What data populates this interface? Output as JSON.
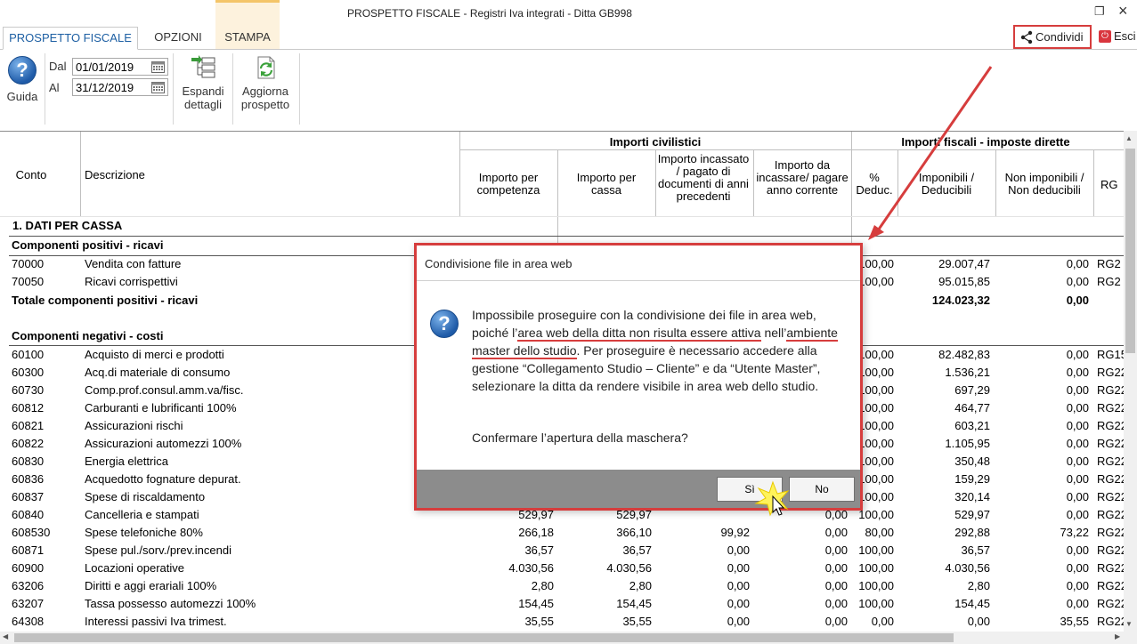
{
  "window": {
    "title": "PROSPETTO FISCALE - Registri Iva integrati - Ditta GB998",
    "restore_glyph": "❐",
    "close_glyph": "×"
  },
  "tabs": [
    {
      "label": "PROSPETTO FISCALE",
      "active": true
    },
    {
      "label": "OPZIONI",
      "active": false
    },
    {
      "label": "STAMPA",
      "active": false
    }
  ],
  "top_actions": {
    "share_label": "Condividi",
    "exit_label": "Esci"
  },
  "ribbon": {
    "help_label": "Guida",
    "from_label": "Dal",
    "from_value": "01/01/2019",
    "to_label": "Al",
    "to_value": "31/12/2019",
    "expand_line1": "Espandi",
    "expand_line2": "dettagli",
    "refresh_line1": "Aggiorna",
    "refresh_line2": "prospetto"
  },
  "grid": {
    "group_civil": "Importi civilistici",
    "group_fiscal": "Importi fiscali - imposte dirette",
    "columns": {
      "conto": "Conto",
      "descrizione": "Descrizione",
      "competenza": "Importo per competenza",
      "cassa": "Importo per cassa",
      "incassato": "Importo incassato / pagato di documenti di anni precedenti",
      "da_incassare": "Importo da incassare/ pagare anno corrente",
      "deduc": "% Deduc.",
      "imponibili": "Imponibili / Deducibili",
      "non_imponibili": "Non imponibili / Non deducibili",
      "rg": "RG"
    },
    "sections": {
      "dati_cassa": "1. DATI PER CASSA",
      "positivi": "Componenti positivi - ricavi",
      "totale_positivi": "Totale componenti positivi - ricavi",
      "totale_imponibili": "124.023,32",
      "totale_non_imponibili": "0,00",
      "negativi": "Componenti negativi - costi"
    },
    "positive_rows": [
      {
        "conto": "70000",
        "desc": "Vendita con fatture",
        "competenza": "",
        "cassa": "",
        "incassato": "",
        "da_incassare": "",
        "deduc": "100,00",
        "imponibili": "29.007,47",
        "non_imponibili": "0,00",
        "rg": "RG2"
      },
      {
        "conto": "70050",
        "desc": "Ricavi corrispettivi",
        "competenza": "",
        "cassa": "",
        "incassato": "",
        "da_incassare": "",
        "deduc": "100,00",
        "imponibili": "95.015,85",
        "non_imponibili": "0,00",
        "rg": "RG2"
      }
    ],
    "negative_rows": [
      {
        "conto": "60100",
        "desc": "Acquisto di merci e prodotti",
        "competenza": "",
        "cassa": "",
        "incassato": "",
        "da_incassare": "",
        "deduc": "100,00",
        "imponibili": "82.482,83",
        "non_imponibili": "0,00",
        "rg": "RG15"
      },
      {
        "conto": "60300",
        "desc": "Acq.di materiale di consumo",
        "competenza": "",
        "cassa": "",
        "incassato": "",
        "da_incassare": "",
        "deduc": "100,00",
        "imponibili": "1.536,21",
        "non_imponibili": "0,00",
        "rg": "RG22"
      },
      {
        "conto": "60730",
        "desc": "Comp.prof.consul.amm.va/fisc.",
        "competenza": "",
        "cassa": "",
        "incassato": "",
        "da_incassare": "",
        "deduc": "100,00",
        "imponibili": "697,29",
        "non_imponibili": "0,00",
        "rg": "RG22"
      },
      {
        "conto": "60812",
        "desc": "Carburanti e lubrificanti 100%",
        "competenza": "",
        "cassa": "",
        "incassato": "",
        "da_incassare": "",
        "deduc": "100,00",
        "imponibili": "464,77",
        "non_imponibili": "0,00",
        "rg": "RG22"
      },
      {
        "conto": "60821",
        "desc": "Assicurazioni rischi",
        "competenza": "",
        "cassa": "",
        "incassato": "",
        "da_incassare": "",
        "deduc": "100,00",
        "imponibili": "603,21",
        "non_imponibili": "0,00",
        "rg": "RG22"
      },
      {
        "conto": "60822",
        "desc": "Assicurazioni automezzi 100%",
        "competenza": "",
        "cassa": "",
        "incassato": "",
        "da_incassare": "",
        "deduc": "100,00",
        "imponibili": "1.105,95",
        "non_imponibili": "0,00",
        "rg": "RG22"
      },
      {
        "conto": "60830",
        "desc": "Energia elettrica",
        "competenza": "",
        "cassa": "",
        "incassato": "",
        "da_incassare": "",
        "deduc": "100,00",
        "imponibili": "350,48",
        "non_imponibili": "0,00",
        "rg": "RG22"
      },
      {
        "conto": "60836",
        "desc": "Acquedotto fognature depurat.",
        "competenza": "",
        "cassa": "",
        "incassato": "",
        "da_incassare": "",
        "deduc": "100,00",
        "imponibili": "159,29",
        "non_imponibili": "0,00",
        "rg": "RG22"
      },
      {
        "conto": "60837",
        "desc": "Spese di riscaldamento",
        "competenza": "",
        "cassa": "",
        "incassato": "",
        "da_incassare": "",
        "deduc": "100,00",
        "imponibili": "320,14",
        "non_imponibili": "0,00",
        "rg": "RG22"
      },
      {
        "conto": "60840",
        "desc": "Cancelleria e stampati",
        "competenza": "529,97",
        "cassa": "529,97",
        "incassato": "",
        "da_incassare": "0,00",
        "deduc": "100,00",
        "imponibili": "529,97",
        "non_imponibili": "0,00",
        "rg": "RG22"
      },
      {
        "conto": "608530",
        "desc": "Spese telefoniche 80%",
        "competenza": "266,18",
        "cassa": "366,10",
        "incassato": "99,92",
        "da_incassare": "0,00",
        "deduc": "80,00",
        "imponibili": "292,88",
        "non_imponibili": "73,22",
        "rg": "RG22"
      },
      {
        "conto": "60871",
        "desc": "Spese pul./sorv./prev.incendi",
        "competenza": "36,57",
        "cassa": "36,57",
        "incassato": "0,00",
        "da_incassare": "0,00",
        "deduc": "100,00",
        "imponibili": "36,57",
        "non_imponibili": "0,00",
        "rg": "RG22"
      },
      {
        "conto": "60900",
        "desc": "Locazioni operative",
        "competenza": "4.030,56",
        "cassa": "4.030,56",
        "incassato": "0,00",
        "da_incassare": "0,00",
        "deduc": "100,00",
        "imponibili": "4.030,56",
        "non_imponibili": "0,00",
        "rg": "RG22"
      },
      {
        "conto": "63206",
        "desc": "Diritti e aggi erariali 100%",
        "competenza": "2,80",
        "cassa": "2,80",
        "incassato": "0,00",
        "da_incassare": "0,00",
        "deduc": "100,00",
        "imponibili": "2,80",
        "non_imponibili": "0,00",
        "rg": "RG22"
      },
      {
        "conto": "63207",
        "desc": "Tassa possesso automezzi 100%",
        "competenza": "154,45",
        "cassa": "154,45",
        "incassato": "0,00",
        "da_incassare": "0,00",
        "deduc": "100,00",
        "imponibili": "154,45",
        "non_imponibili": "0,00",
        "rg": "RG22"
      },
      {
        "conto": "64308",
        "desc": "Interessi passivi Iva trimest.",
        "competenza": "35,55",
        "cassa": "35,55",
        "incassato": "0,00",
        "da_incassare": "0,00",
        "deduc": "0,00",
        "imponibili": "0,00",
        "non_imponibili": "35,55",
        "rg": "RG22"
      }
    ]
  },
  "dialog": {
    "title": "Condivisione file in area web",
    "msg_part1": "Impossibile proseguire con la condivisione dei file in area web, poiché l’",
    "msg_highlight1": "area web della ditta non risulta essere attiva",
    "msg_part2": "nell’",
    "msg_highlight2": "ambiente master dello studio",
    "msg_part3": ". Per proseguire è necessario accedere alla gestione “Collegamento Studio – Cliente” e da “Utente Master”, selezionare la ditta da rendere visibile in area web dello studio.",
    "confirm": "Confermare l’apertura della maschera?",
    "yes_label": "Sì",
    "no_label": "No"
  },
  "colors": {
    "highlight_red": "#d63d3d",
    "active_tab_text": "#1d5fa3",
    "stampa_tab_bg": "#fdf2dd",
    "dialog_footer": "#8c8c8c"
  },
  "icons": [
    "question-icon",
    "calendar-icon",
    "expand-details-icon",
    "refresh-icon",
    "share-icon",
    "exit-icon"
  ]
}
